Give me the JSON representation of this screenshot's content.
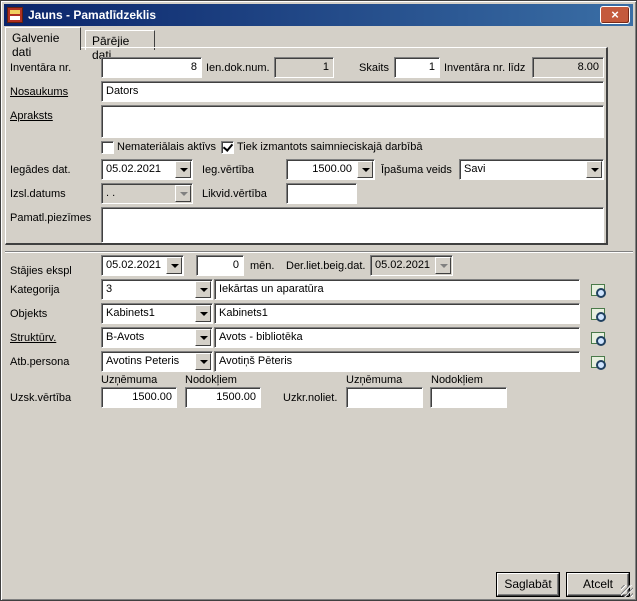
{
  "window": {
    "title": "Jauns - Pamatlīdzeklis",
    "close": "×"
  },
  "tabs": [
    "Galvenie dati",
    "Pārējie dati"
  ],
  "labels": {
    "inv_nr": "Inventāra nr.",
    "ien_dok": "Ien.dok.num.",
    "skaits": "Skaits",
    "inv_nr_lidz": "Inventāra nr. līdz",
    "nosaukums": "Nosaukums",
    "apraksts": "Apraksts",
    "nematerialais": "Nemateriālais aktīvs",
    "tiek_izmantots": "Tiek izmantots saimnieciskajā darbībā",
    "iegades_dat": "Iegādes dat.",
    "ieg_vertiba": "Ieg.vērtība",
    "ipasuma_veids": "Īpašuma veids",
    "izsl_datums": "Izsl.datums",
    "likvid_vertiba": "Likvid.vērtība",
    "pamatl_piezimes": "Pamatl.piezīmes",
    "stajies_ekspl": "Stājies ekspl",
    "men": "mēn.",
    "der_liet_beig_dat": "Der.liet.beig.dat.",
    "kategorija": "Kategorija",
    "objekts": "Objekts",
    "strukturv": "Struktūrv.",
    "atb_persona": "Atb.persona",
    "uznemuma_1": "Uzņēmuma",
    "nodokliem_1": "Nodokļiem",
    "uzsk_vertiba": "Uzsk.vērtība",
    "uzkr_noliet": "Uzkr.noliet.",
    "uznemuma_2": "Uzņēmuma",
    "nodokliem_2": "Nodokļiem"
  },
  "values": {
    "inv_nr": "8",
    "ien_dok": "1",
    "skaits": "1",
    "inv_nr_lidz": "8.00",
    "nosaukums": "Dators",
    "apraksts": "",
    "iegades_dat": "05.02.2021",
    "ieg_vertiba": "1500.00",
    "ipasuma_veids": "Savi",
    "izsl_datums": ". .",
    "likvid_vertiba": "",
    "pamatl_piezimes": "",
    "stajies_ekspl": "05.02.2021",
    "men": "0",
    "der_liet_beig_dat": "05.02.2021",
    "kategorija_code": "3",
    "kategorija_name": "Iekārtas un aparatūra",
    "objekts_code": "Kabinets1",
    "objekts_name": "Kabinets1",
    "strukturv_code": "B-Avots",
    "strukturv_name": "Avots - bibliotēka",
    "atb_code": "Avotins Peteris",
    "atb_name": "Avotiņš Pēteris",
    "uzsk_uznemuma": "1500.00",
    "uzsk_nodokliem": "1500.00",
    "uzkr_uznemuma": "",
    "uzkr_nodokliem": ""
  },
  "buttons": {
    "save": "Saglabāt",
    "cancel": "Atcelt"
  }
}
